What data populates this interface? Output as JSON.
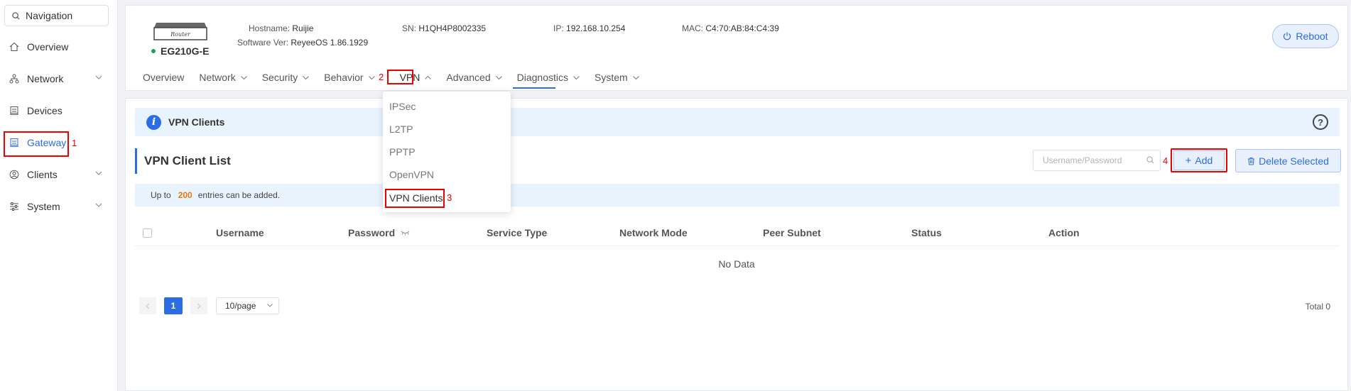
{
  "sidebar": {
    "search_label": "Navigation",
    "items": [
      {
        "label": "Overview",
        "icon": "home-icon",
        "has_children": false
      },
      {
        "label": "Network",
        "icon": "network-icon",
        "has_children": true
      },
      {
        "label": "Devices",
        "icon": "devices-icon",
        "has_children": false
      },
      {
        "label": "Gateway",
        "icon": "gateway-icon",
        "has_children": false,
        "active": true
      },
      {
        "label": "Clients",
        "icon": "clients-icon",
        "has_children": true
      },
      {
        "label": "System",
        "icon": "system-icon",
        "has_children": true
      }
    ]
  },
  "header": {
    "device_image_label": "Router",
    "model": "EG210G-E",
    "hostname_label": "Hostname:",
    "hostname": "Ruijie",
    "software_label": "Software Ver:",
    "software": "ReyeeOS 1.86.1929",
    "sn_label": "SN:",
    "sn": "H1QH4P8002335",
    "ip_label": "IP:",
    "ip": "192.168.10.254",
    "mac_label": "MAC:",
    "mac": "C4:70:AB:84:C4:39",
    "reboot_label": "Reboot",
    "tabs": [
      {
        "label": "Overview",
        "chevron": false
      },
      {
        "label": "Network",
        "chevron": true
      },
      {
        "label": "Security",
        "chevron": true
      },
      {
        "label": "Behavior",
        "chevron": true
      },
      {
        "label": "VPN",
        "chevron": true,
        "active": true
      },
      {
        "label": "Advanced",
        "chevron": true
      },
      {
        "label": "Diagnostics",
        "chevron": true
      },
      {
        "label": "System",
        "chevron": true
      }
    ]
  },
  "vpn_menu": {
    "items": [
      "IPSec",
      "L2TP",
      "PPTP",
      "OpenVPN",
      "VPN Clients"
    ],
    "selected": "VPN Clients"
  },
  "main": {
    "banner_title": "VPN Clients",
    "help_glyph": "?",
    "list_title": "VPN Client List",
    "search_placeholder": "Username/Password",
    "add_label": "Add",
    "delete_label": "Delete Selected",
    "limit_prefix": "Up to",
    "limit_value": "200",
    "limit_suffix": "entries can be added.",
    "columns": [
      "Username",
      "Password",
      "Service Type",
      "Network Mode",
      "Peer Subnet",
      "Status",
      "Action"
    ],
    "empty_text": "No Data",
    "pager": {
      "current_page": "1",
      "page_size": "10/page",
      "total": "Total 0"
    }
  },
  "annotations": {
    "step1": "1",
    "step2": "2",
    "step3": "3",
    "step4": "4",
    "color": "#e00000"
  },
  "colors": {
    "accent": "#2b6de5",
    "highlight": "#e6780c",
    "online": "#18a058"
  }
}
